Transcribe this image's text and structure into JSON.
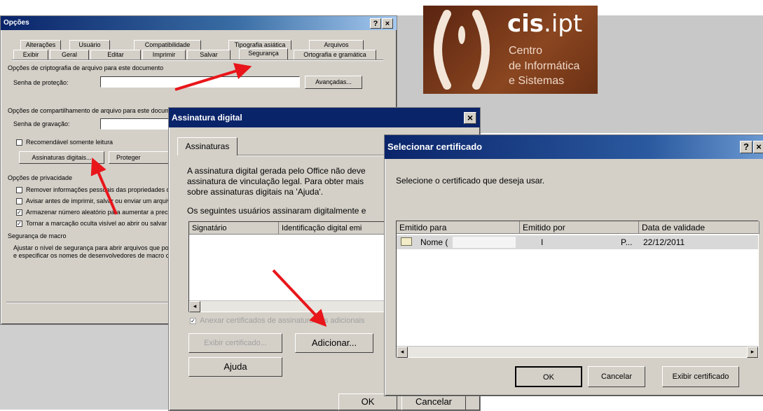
{
  "opcoes": {
    "title": "Opções",
    "help_btn": "?",
    "close_btn": "×",
    "tabs_row1": [
      "Alterações",
      "Usuário",
      "Compatibilidade",
      "Tipografia asiática",
      "Arquivos"
    ],
    "tabs_row2": [
      "Exibir",
      "Geral",
      "Editar",
      "Imprimir",
      "Salvar",
      "Segurança",
      "Ortografia e gramática"
    ],
    "sec_encrypt": "Opções de criptografia de arquivo para este documento",
    "lbl_protect": "Senha de proteção:",
    "btn_advanced": "Avançadas...",
    "sec_share": "Opções de compartilhamento de arquivo para este documento",
    "lbl_write": "Senha de gravação:",
    "cb_readonly": "Recomendável somente leitura",
    "btn_signatures": "Assinaturas digitais...",
    "btn_protect": "Proteger Documento...",
    "sec_privacy": "Opções de privacidade",
    "cb_remove": "Remover informações pessoais das propriedades do arquivo ao salvar",
    "cb_warn": "Avisar antes de imprimir, salvar ou enviar um arquivo que contenha alterações",
    "cb_random": "Armazenar número aleatório para aumentar a precisão da mesclagem",
    "cb_markup": "Tornar a marcação oculta visível ao abrir ou salvar",
    "sec_macro": "Segurança de macro",
    "macro_text1": "Ajustar o nível de segurança para abrir arquivos que possam conter vírus de macro",
    "macro_text2": "e especificar os nomes de desenvolvedores de macro confiáveis."
  },
  "logo": {
    "brand_bold": "cis",
    "brand_rest": ".ipt",
    "line1": "Centro",
    "line2": "de Informática",
    "line3": "e Sistemas",
    "bg_color": "#7a3a1c"
  },
  "assinatura": {
    "title": "Assinatura digital",
    "close_btn": "×",
    "tab": "Assinaturas",
    "para1": "A assinatura digital gerada pelo Office não deve",
    "para2": "assinatura de vinculação legal. Para obter mais",
    "para3": "sobre assinaturas digitais na 'Ajuda'.",
    "users_text": "Os seguintes usuários assinaram digitalmente e",
    "col_signer": "Signatário",
    "col_id": "Identificação digital emi",
    "cb_attach": "Anexar certificados de assinatura nos adicionais",
    "btn_view": "Exibir certificado...",
    "btn_add": "Adicionar...",
    "btn_help": "Ajuda",
    "btn_ok": "OK",
    "btn_cancel": "Cancelar"
  },
  "certificado": {
    "title": "Selecionar certificado",
    "help_btn": "?",
    "close_btn": "×",
    "prompt": "Selecione o certificado que deseja usar.",
    "col_issued_to": "Emitido para",
    "col_issued_by": "Emitido por",
    "col_valid": "Data de validade",
    "row_name": "Nome (",
    "row_issuer": "I",
    "row_issuer_end": "P...",
    "row_date": "22/12/2011",
    "btn_ok": "OK",
    "btn_cancel": "Cancelar",
    "btn_view": "Exibir certificado"
  },
  "colors": {
    "arrow": "#e8161b",
    "title_blue": "#0a246a",
    "dialog_gray": "#d4d0c8"
  }
}
